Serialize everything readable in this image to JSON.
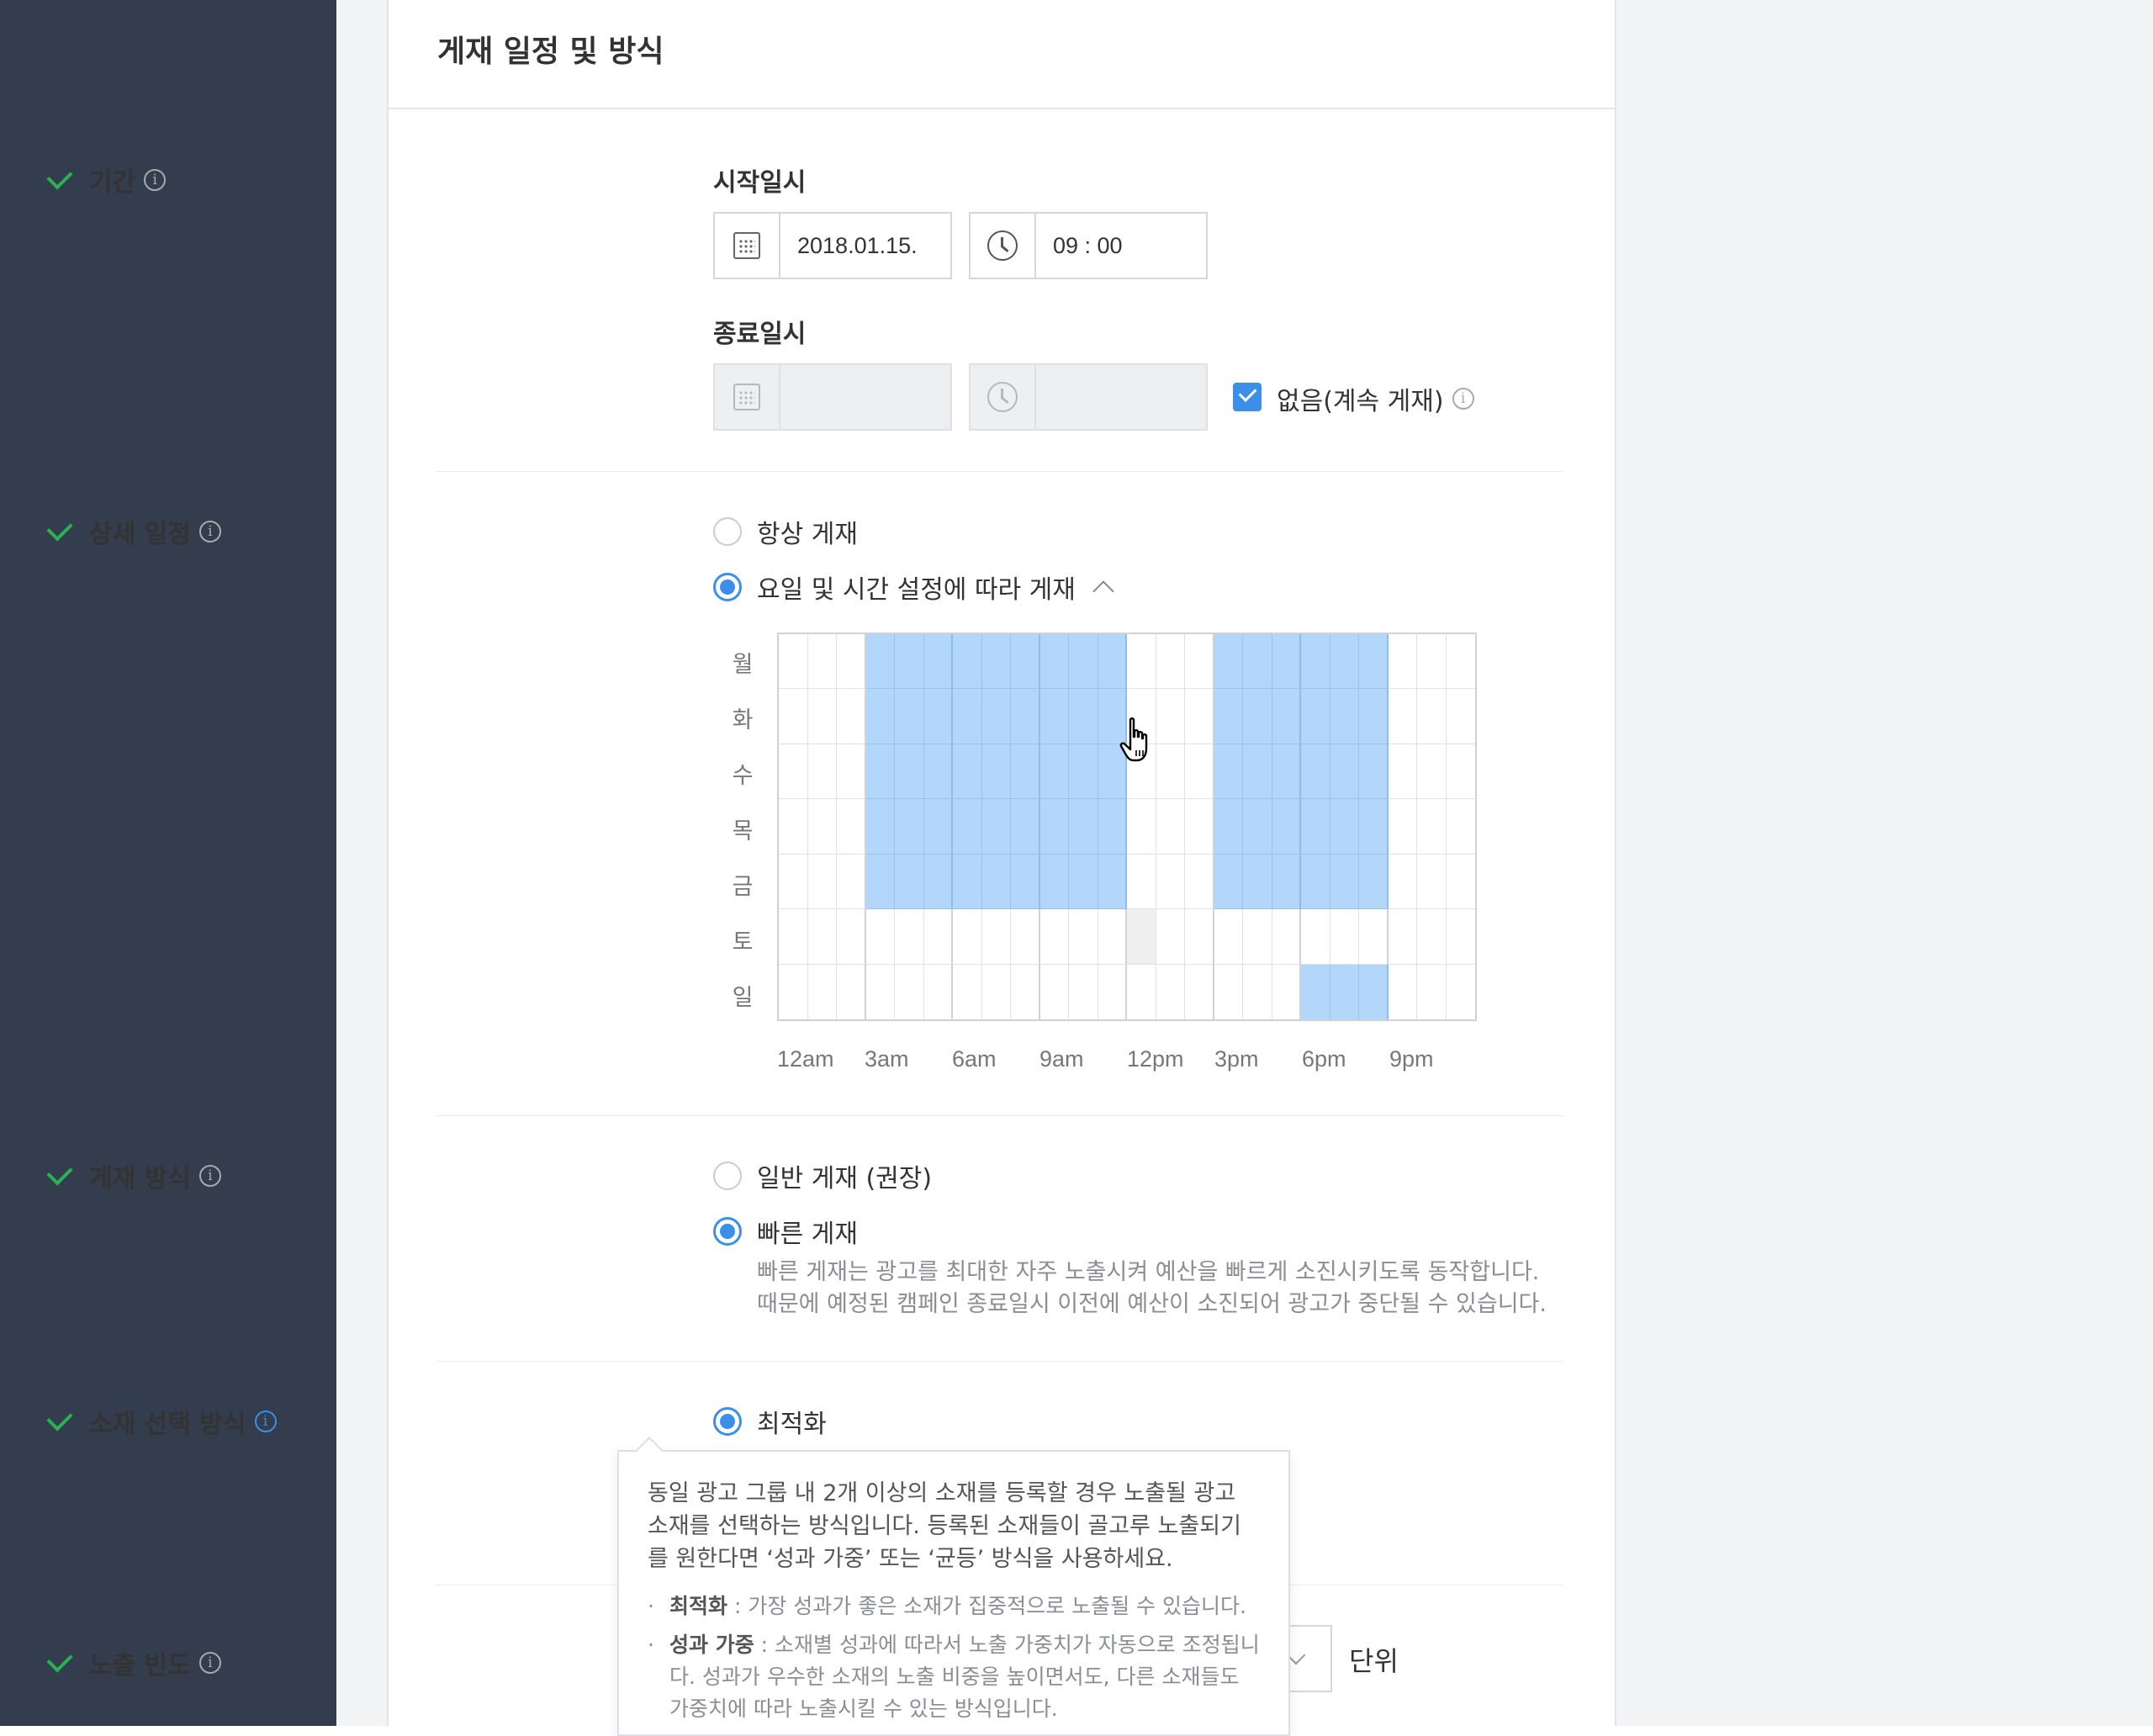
{
  "panel": {
    "title": "게재 일정 및 방식"
  },
  "period": {
    "label": "기간",
    "start_label": "시작일시",
    "start_date": "2018.01.15.",
    "start_time": "09 : 00",
    "end_label": "종료일시",
    "end_date": "",
    "end_time": "",
    "no_end_checked": true,
    "no_end_label": "없음(계속 게재)"
  },
  "detail_schedule": {
    "label": "상세 일정",
    "options": [
      {
        "label": "항상 게재",
        "selected": false
      },
      {
        "label": "요일 및 시간 설정에 따라 게재",
        "selected": true
      }
    ],
    "days": [
      "월",
      "화",
      "수",
      "목",
      "금",
      "토",
      "일"
    ],
    "hour_labels": [
      "12am",
      "3am",
      "6am",
      "9am",
      "12pm",
      "3pm",
      "6pm",
      "9pm"
    ],
    "selected_slots": [
      {
        "days": [
          "월",
          "화",
          "수",
          "목",
          "금"
        ],
        "hours_from": 3,
        "hours_to": 12
      },
      {
        "days": [
          "월",
          "화",
          "수",
          "목",
          "금"
        ],
        "hours_from": 15,
        "hours_to": 21
      },
      {
        "days": [
          "일"
        ],
        "hours_from": 18,
        "hours_to": 21
      }
    ],
    "hover_slot": {
      "day": "토",
      "hour": 12
    }
  },
  "delivery": {
    "label": "게재 방식",
    "options": [
      {
        "label": "일반 게재 (권장)",
        "selected": false
      },
      {
        "label": "빠른 게재",
        "selected": true
      }
    ],
    "description_line1": "빠른 게재는 광고를 최대한 자주 노출시켜 예산을 빠르게 소진시키도록 동작합니다.",
    "description_line2": "때문에 예정된 캠페인 종료일시 이전에 예산이 소진되어 광고가 중단될 수 있습니다."
  },
  "creative_selection": {
    "label": "소재 선택 방식",
    "option": "최적화",
    "tooltip": {
      "main": "동일 광고 그룹 내 2개 이상의 소재를 등록할 경우 노출될 광고 소재를 선택하는 방식입니다. 등록된 소재들이 골고루 노출되기를 원한다면 ‘성과 가중’ 또는 ‘균등’ 방식을 사용하세요.",
      "bullet1_title": "최적화",
      "bullet1_text": " : 가장 성과가 좋은 소재가 집중적으로 노출될 수 있습니다.",
      "bullet2_title": "성과 가중",
      "bullet2_text": " : 소재별 성과에 따라서 노출 가중치가 자동으로 조정됩니다. 성과가 우수한 소재의 노출 비중을 높이면서도, 다른 소재들도 가중치에 따라 노출시킬 수 있는 방식입니다."
    }
  },
  "frequency": {
    "label": "노출 빈도",
    "unit": "단위"
  },
  "colors": {
    "sidebar": "#333d4d",
    "accent": "#3b8fe8",
    "check": "#27b34f",
    "slot_selected": "#b3d7fb"
  }
}
